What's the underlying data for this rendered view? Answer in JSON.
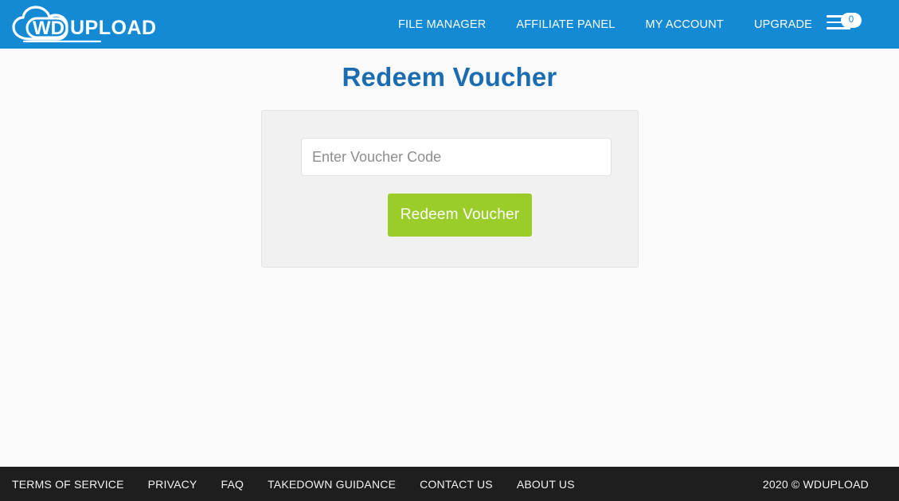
{
  "header": {
    "logo": {
      "name": "wdupload-logo",
      "text_primary": "WD",
      "text_secondary": "UPLOAD"
    },
    "nav": [
      {
        "label": "FILE MANAGER",
        "name": "nav-file-manager"
      },
      {
        "label": "AFFILIATE PANEL",
        "name": "nav-affiliate-panel"
      },
      {
        "label": "MY ACCOUNT",
        "name": "nav-my-account"
      },
      {
        "label": "UPGRADE",
        "name": "nav-upgrade"
      }
    ],
    "menu_toggle": {
      "icon": "hamburger-menu-icon",
      "badge_count": "0"
    },
    "background_color": "#1489d4"
  },
  "main": {
    "page_title": "Redeem Voucher",
    "title_color": "#1b6cb0",
    "form": {
      "voucher_input_placeholder": "Enter Voucher Code",
      "voucher_input_value": "",
      "submit_label": "Redeem Voucher",
      "submit_color": "#9acd29",
      "panel_background": "#f1f1f1"
    }
  },
  "footer": {
    "links": [
      {
        "label": "TERMS OF SERVICE",
        "name": "footer-terms-of-service"
      },
      {
        "label": "PRIVACY",
        "name": "footer-privacy"
      },
      {
        "label": "FAQ",
        "name": "footer-faq"
      },
      {
        "label": "TAKEDOWN GUIDANCE",
        "name": "footer-takedown-guidance"
      },
      {
        "label": "CONTACT US",
        "name": "footer-contact-us"
      },
      {
        "label": "ABOUT US",
        "name": "footer-about-us"
      }
    ],
    "copyright": "2020 © WDUPLOAD",
    "background_color": "#1e1e1e"
  }
}
